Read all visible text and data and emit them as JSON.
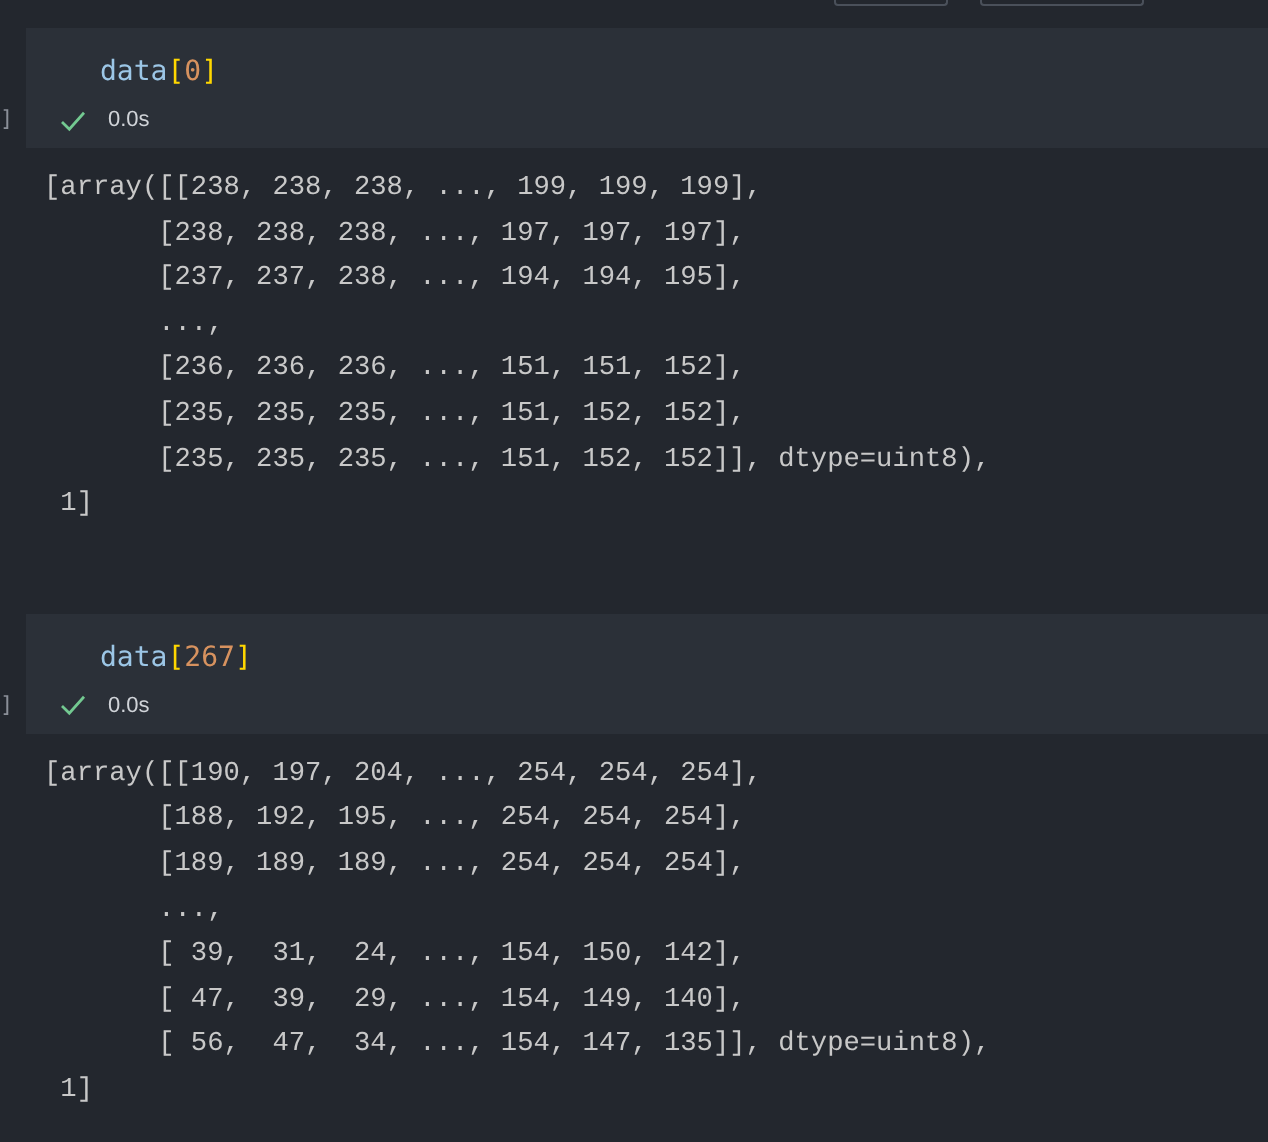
{
  "cells": [
    {
      "code": [
        {
          "kind": "name",
          "text": "data"
        },
        {
          "kind": "bracket",
          "text": "["
        },
        {
          "kind": "number",
          "text": "0"
        },
        {
          "kind": "bracket",
          "text": "]"
        }
      ],
      "gutter": "]",
      "time": "0.0s",
      "output_lines": [
        "[array([[238, 238, 238, ..., 199, 199, 199],",
        "       [238, 238, 238, ..., 197, 197, 197],",
        "       [237, 237, 238, ..., 194, 194, 195],",
        "       ...,",
        "       [236, 236, 236, ..., 151, 151, 152],",
        "       [235, 235, 235, ..., 151, 152, 152],",
        "       [235, 235, 235, ..., 151, 152, 152]], dtype=uint8),",
        " 1]"
      ]
    },
    {
      "code": [
        {
          "kind": "name",
          "text": "data"
        },
        {
          "kind": "bracket",
          "text": "["
        },
        {
          "kind": "number",
          "text": "267"
        },
        {
          "kind": "bracket",
          "text": "]"
        }
      ],
      "gutter": "]",
      "time": "0.0s",
      "output_lines": [
        "[array([[190, 197, 204, ..., 254, 254, 254],",
        "       [188, 192, 195, ..., 254, 254, 254],",
        "       [189, 189, 189, ..., 254, 254, 254],",
        "       ...,",
        "       [ 39,  31,  24, ..., 154, 150, 142],",
        "       [ 47,  39,  29, ..., 154, 149, 140],",
        "       [ 56,  47,  34, ..., 154, 147, 135]], dtype=uint8),",
        " 1]"
      ]
    }
  ]
}
